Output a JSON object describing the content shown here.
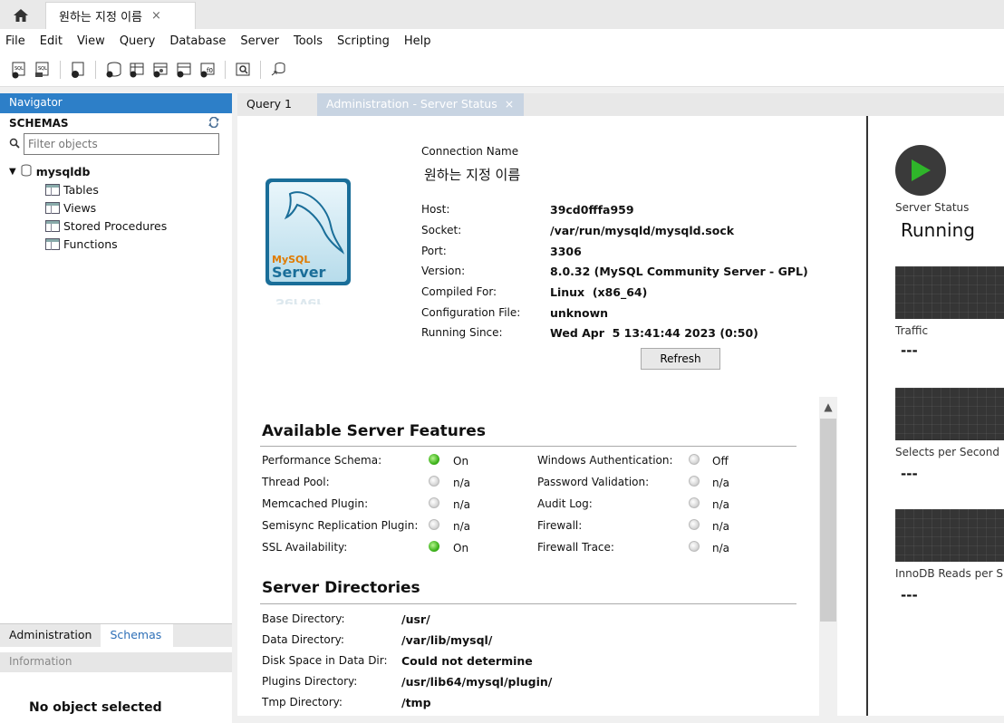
{
  "tabstrip": {
    "connection_tab": "원하는 지정 이름",
    "close": "×"
  },
  "menu": [
    "File",
    "Edit",
    "View",
    "Query",
    "Database",
    "Server",
    "Tools",
    "Scripting",
    "Help"
  ],
  "navigator": {
    "header": "Navigator",
    "schemas_title": "SCHEMAS",
    "filter_placeholder": "Filter objects",
    "schema": "mysqldb",
    "children": [
      "Tables",
      "Views",
      "Stored Procedures",
      "Functions"
    ],
    "bottom_tabs": [
      "Administration",
      "Schemas"
    ],
    "info_header": "Information",
    "no_object": "No object selected"
  },
  "editor_tabs": [
    "Query 1",
    "Administration - Server Status"
  ],
  "connection": {
    "name_label": "Connection Name",
    "name_value": "원하는 지정 이름",
    "rows": [
      {
        "label": "Host:",
        "value": "39cd0fffa959"
      },
      {
        "label": "Socket:",
        "value": "/var/run/mysqld/mysqld.sock"
      },
      {
        "label": "Port:",
        "value": "3306"
      },
      {
        "label": "Version:",
        "value": "8.0.32 (MySQL Community Server - GPL)"
      },
      {
        "label": "Compiled For:",
        "value": "Linux  (x86_64)"
      },
      {
        "label": "Configuration File:",
        "value": "unknown"
      },
      {
        "label": "Running Since:",
        "value": "Wed Apr  5 13:41:44 2023 (0:50)"
      }
    ],
    "refresh": "Refresh",
    "logo": {
      "brand": "MySQL",
      "product": "Server"
    }
  },
  "features": {
    "title": "Available Server Features",
    "left": [
      {
        "label": "Performance Schema:",
        "value": "On",
        "on": true
      },
      {
        "label": "Thread Pool:",
        "value": "n/a",
        "on": false
      },
      {
        "label": "Memcached Plugin:",
        "value": "n/a",
        "on": false
      },
      {
        "label": "Semisync Replication Plugin:",
        "value": "n/a",
        "on": false
      },
      {
        "label": "SSL Availability:",
        "value": "On",
        "on": true
      }
    ],
    "right": [
      {
        "label": "Windows Authentication:",
        "value": "Off",
        "on": false
      },
      {
        "label": "Password Validation:",
        "value": "n/a",
        "on": false
      },
      {
        "label": "Audit Log:",
        "value": "n/a",
        "on": false
      },
      {
        "label": "Firewall:",
        "value": "n/a",
        "on": false
      },
      {
        "label": "Firewall Trace:",
        "value": "n/a",
        "on": false
      }
    ]
  },
  "directories": {
    "title": "Server Directories",
    "rows": [
      {
        "label": "Base Directory:",
        "value": "/usr/"
      },
      {
        "label": "Data Directory:",
        "value": "/var/lib/mysql/"
      },
      {
        "label": "Disk Space in Data Dir:",
        "value": "Could not determine"
      },
      {
        "label": "Plugins Directory:",
        "value": "/usr/lib64/mysql/plugin/"
      },
      {
        "label": "Tmp Directory:",
        "value": "/tmp"
      }
    ]
  },
  "status_panel": {
    "server_status_label": "Server Status",
    "server_status_value": "Running",
    "metrics": [
      {
        "label": "Traffic",
        "value": "---"
      },
      {
        "label": "Selects per Second",
        "value": "---"
      },
      {
        "label": "InnoDB Reads per S",
        "value": "---"
      }
    ]
  },
  "colors": {
    "accent": "#2d7fc8",
    "led_on": "#3db21b",
    "play": "#2fb52a"
  }
}
